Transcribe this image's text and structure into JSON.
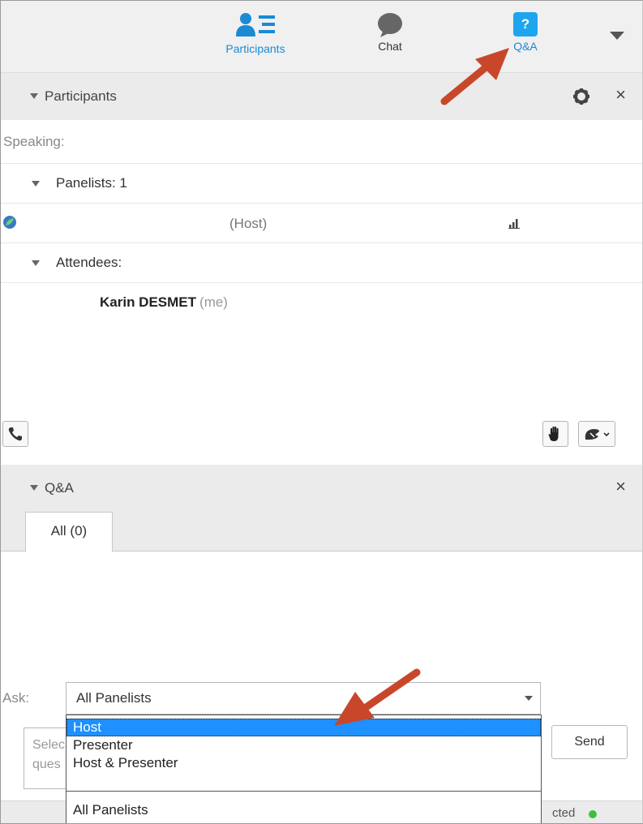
{
  "toolbar": {
    "participants_label": "Participants",
    "chat_label": "Chat",
    "qa_label": "Q&A",
    "qa_icon_glyph": "?"
  },
  "participants_panel": {
    "title": "Participants",
    "close_glyph": "×",
    "speaking_label": "Speaking:",
    "panelists_label": "Panelists: 1",
    "host_label": "(Host)",
    "attendees_label": "Attendees:",
    "attendee_name": "Karin DESMET",
    "attendee_tag": "(me)"
  },
  "qa_panel": {
    "title": "Q&A",
    "close_glyph": "×",
    "tab_all": "All (0)",
    "ask_label": "Ask:",
    "ask_selected": "All Panelists",
    "input_placeholder_line1": "Selec",
    "input_placeholder_line2": "ques",
    "send_label": "Send",
    "status_text": "cted"
  },
  "dropdown": {
    "options": [
      "Host",
      "Presenter",
      "Host & Presenter",
      "All Panelists"
    ],
    "highlighted": "Host"
  },
  "colors": {
    "accent": "#1a8ad4",
    "qa_icon_bg": "#1ea5f0",
    "selection": "#1e90ff",
    "arrow": "#c8472a",
    "connected_dot": "#3cc13c"
  },
  "icons": [
    "participants-icon",
    "chat-bubble-icon",
    "question-icon",
    "gear-icon",
    "close-icon",
    "phone-icon",
    "raise-hand-icon",
    "reaction-icon",
    "signal-icon"
  ]
}
